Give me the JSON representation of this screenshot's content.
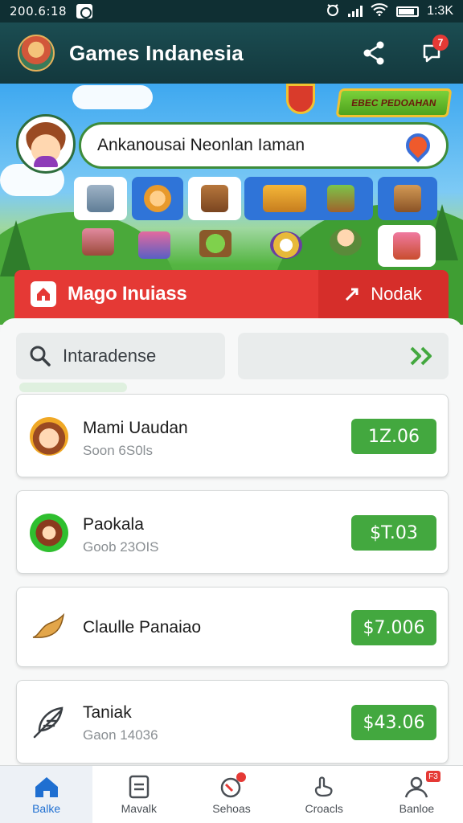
{
  "status_bar": {
    "time_left": "200.6:18",
    "time_right": "1:3K"
  },
  "header": {
    "title": "Games Indanesia",
    "notification_count": "7"
  },
  "banner": {
    "logo_text": "EBEC PEDOAHAN",
    "search_text": "Ankanousai Neonlan Iaman"
  },
  "promo_bar": {
    "title": "Mago Inuiass",
    "action_label": "Nodak"
  },
  "search": {
    "placeholder": "Intaradense"
  },
  "list": [
    {
      "name": "Mami Uaudan",
      "sub": "Soon 6S0ls",
      "price": "1Z.06",
      "avatar": "girl-avatar"
    },
    {
      "name": "Paokala",
      "sub": "Goob 23OIS",
      "price": "$T.03",
      "avatar": "dwarf-avatar"
    },
    {
      "name": "Claulle Panaiao",
      "sub": "",
      "price": "$7.006",
      "avatar": "leaf-icon"
    },
    {
      "name": "Taniak",
      "sub": "Gaon 14036",
      "price": "$43.06",
      "avatar": "feather-icon"
    }
  ],
  "bottom_nav": [
    {
      "label": "Balke",
      "icon": "home-icon",
      "active": true
    },
    {
      "label": "Mavalk",
      "icon": "document-icon"
    },
    {
      "label": "Sehoas",
      "icon": "trophy-icon"
    },
    {
      "label": "Croacls",
      "icon": "hand-icon"
    },
    {
      "label": "Banloe",
      "icon": "profile-icon",
      "badge": "F3"
    }
  ],
  "colors": {
    "header": "#1b4d52",
    "accent_red": "#e53935",
    "price_green": "#43a83f",
    "active_blue": "#1f6fd1"
  }
}
